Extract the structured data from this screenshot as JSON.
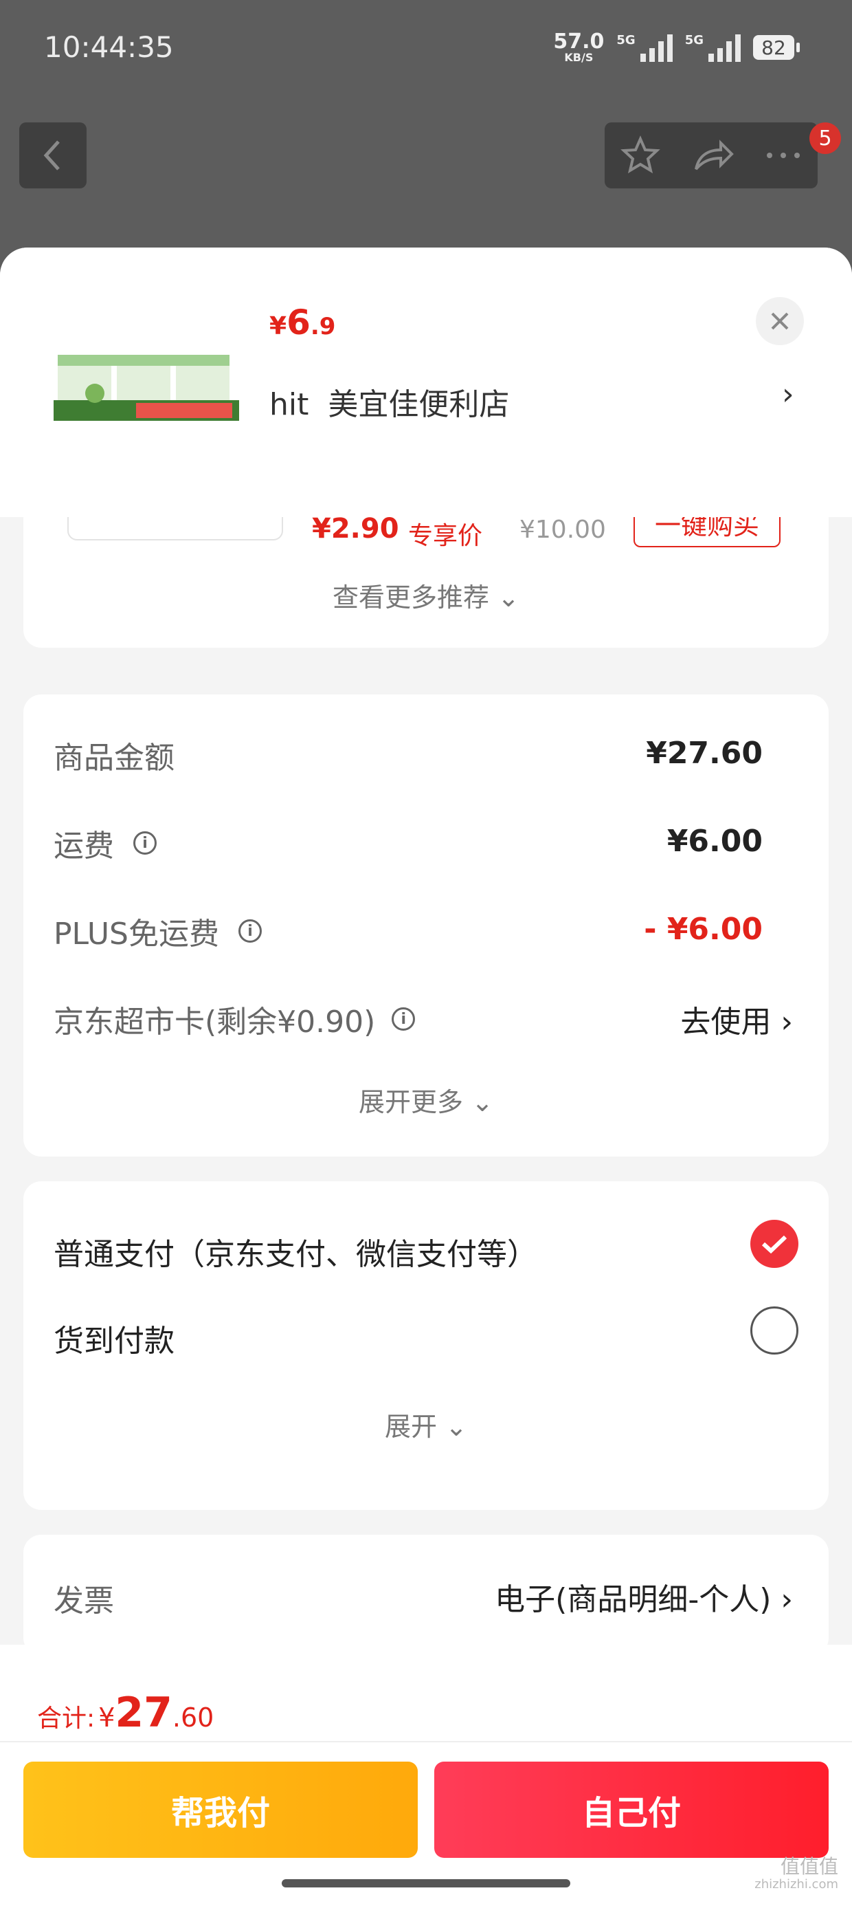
{
  "status_bar": {
    "time": "10:44:35",
    "net_speed": "57.0",
    "net_unit": "KB/S",
    "sig1": "5G",
    "sig2": "5G",
    "battery": "82"
  },
  "nav": {
    "badge_count": "5"
  },
  "product": {
    "price_currency": "¥",
    "price_int": "6",
    "price_dec": ".9",
    "store_prefix": "hit",
    "store_name": "美宜佳便利店"
  },
  "recommend": {
    "price": "¥2.90",
    "tag": "专享价",
    "original": "¥10.00",
    "buy_button": "一键购买",
    "more_label": "查看更多推荐"
  },
  "fees": {
    "rows": [
      {
        "label": "商品金额",
        "value": "¥27.60"
      },
      {
        "label": "运费",
        "value": "¥6.00"
      },
      {
        "label": "PLUS免运费",
        "value": "- ¥6.00"
      },
      {
        "label": "京东超市卡(剩余¥0.90)",
        "value": "去使用"
      }
    ],
    "expand_label": "展开更多"
  },
  "payment": {
    "options": [
      {
        "label": "普通支付（京东支付、微信支付等）",
        "selected": true
      },
      {
        "label": "货到付款",
        "selected": false
      }
    ],
    "expand_label": "展开"
  },
  "invoice": {
    "label": "发票",
    "value": "电子(商品明细-个人)"
  },
  "footer": {
    "total_label": "合计:",
    "total_currency": "¥",
    "total_int": "27",
    "total_dec": ".60",
    "help_pay": "帮我付",
    "self_pay": "自己付"
  },
  "watermark": {
    "line1": "值值值",
    "line2": "zhizhizhi.com"
  },
  "colors": {
    "accent_red": "#e2231a",
    "help_yellow": "#ffb412",
    "pay_red": "#ff2a3d"
  }
}
